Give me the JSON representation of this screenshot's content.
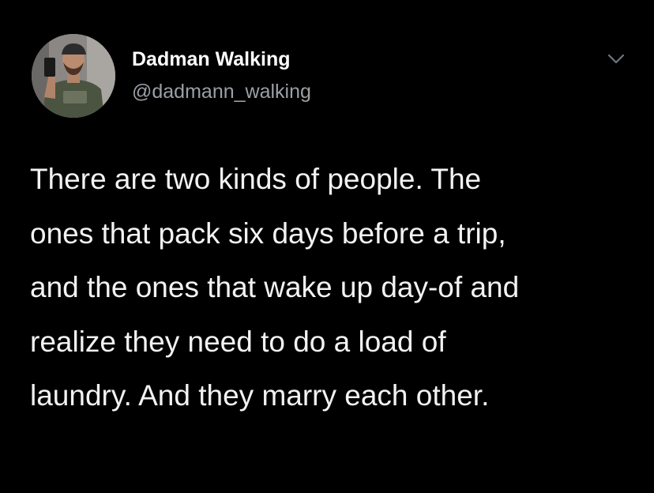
{
  "tweet": {
    "author": {
      "display_name": "Dadman Walking",
      "handle": "@dadmann_walking",
      "avatar_icon": "profile-photo-icon"
    },
    "menu_icon": "chevron-down-icon",
    "text_lines": [
      "There are two kinds of people. The",
      "ones that pack six days before a trip,",
      "and the ones that wake up day-of and",
      "realize they need to do a load of",
      "laundry. And they marry each other."
    ]
  },
  "colors": {
    "background": "#000000",
    "name": "#ffffff",
    "handle": "#9aa0a6",
    "body_text": "#f2f2f2",
    "chevron": "#6e767d"
  }
}
